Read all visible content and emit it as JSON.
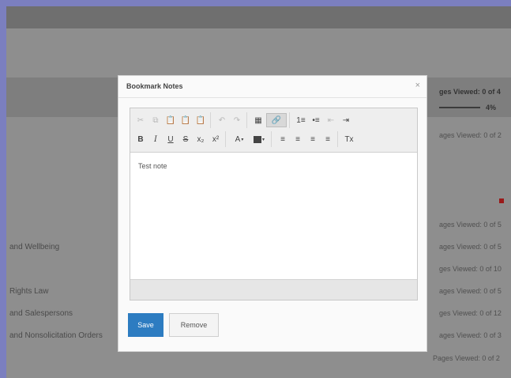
{
  "background": {
    "top_right_label": "ges Viewed: 0 of 4",
    "progress_percent": "4%",
    "left_items": [
      "and Wellbeing",
      "Rights Law",
      "and Salespersons",
      "and Nonsolicitation Orders"
    ],
    "right_items": [
      "ages Viewed: 0 of 2",
      "ages Viewed: 0 of 5",
      "ages Viewed: 0 of 5",
      "ges Viewed: 0 of 10",
      "ages Viewed: 0 of 5",
      "ges Viewed: 0 of 12",
      "ages Viewed: 0 of 3",
      "Pages Viewed: 0 of 2"
    ]
  },
  "modal": {
    "title": "Bookmark Notes",
    "close_glyph": "×",
    "content_text": "Test note",
    "save_label": "Save",
    "remove_label": "Remove"
  },
  "toolbar": {
    "row1": {
      "cut": "✂",
      "copy": "⧉",
      "paste": "📋",
      "paste_text": "📋",
      "paste_word": "📋",
      "undo": "↶",
      "redo": "↷",
      "image": "▦",
      "link": "🔗",
      "ordered_list": "1≡",
      "bullet_list": "•≡",
      "outdent": "⇤",
      "indent": "⇥"
    },
    "row2": {
      "bold": "B",
      "italic": "I",
      "underline": "U",
      "strike": "S",
      "subscript": "x₂",
      "superscript": "x²",
      "text_color": "A",
      "align_left": "≡",
      "align_center": "≡",
      "align_right": "≡",
      "justify": "≡",
      "remove_format": "Tx"
    }
  },
  "colors": {
    "save_button": "#2d7cc1",
    "overlay_background": "#8e8e8e",
    "frame": "#7b7fbf",
    "alert_dot": "#9a1a1a"
  }
}
